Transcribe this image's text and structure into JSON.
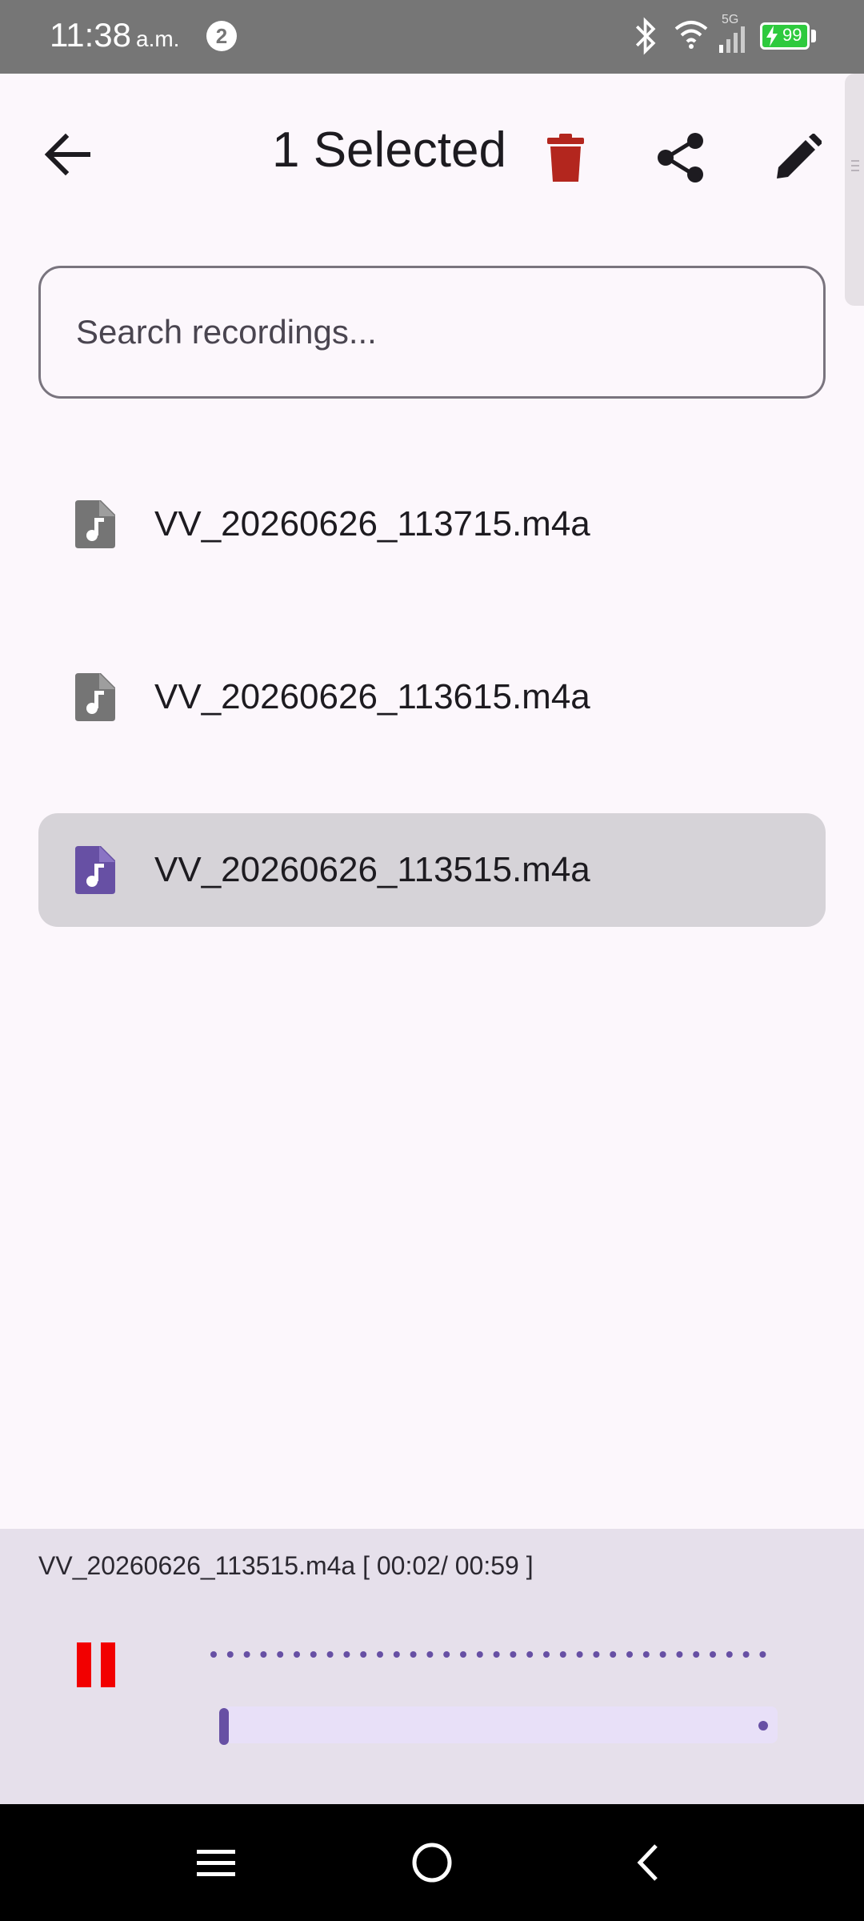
{
  "status_bar": {
    "time": "11:38",
    "ampm": "a.m.",
    "notification_count": "2",
    "network_label": "5G",
    "battery": "99",
    "battery_color": "#2eca3e"
  },
  "app_bar": {
    "title": "1 Selected",
    "actions": [
      "delete-icon",
      "share-icon",
      "edit-icon"
    ],
    "delete_color": "#b3261e"
  },
  "search": {
    "placeholder": "Search recordings...",
    "value": ""
  },
  "recordings": [
    {
      "name": "VV_20260626_113715.m4a",
      "selected": false
    },
    {
      "name": "VV_20260626_113615.m4a",
      "selected": false
    },
    {
      "name": "VV_20260626_113515.m4a",
      "selected": true
    }
  ],
  "player": {
    "now_playing": "VV_20260626_113515.m4a [ 00:02/ 00:59 ]",
    "state": "playing",
    "progress_fraction": 0.034,
    "accent": "#6750a4",
    "pause_color": "#f20000"
  },
  "nav_bar": {
    "buttons": [
      "menu-icon",
      "home-icon",
      "back-icon"
    ]
  }
}
